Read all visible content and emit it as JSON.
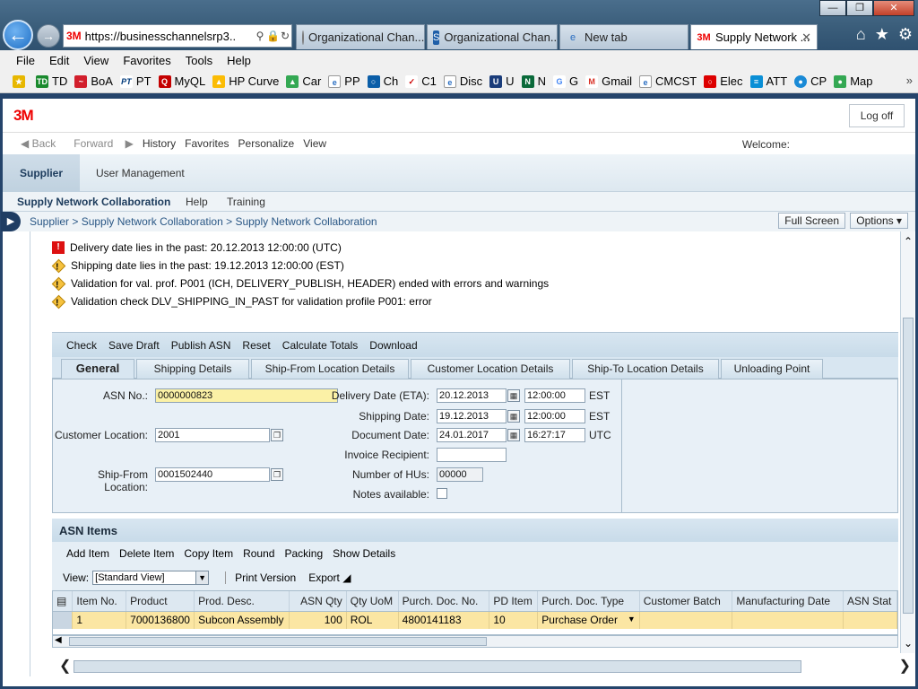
{
  "browser": {
    "address_url": "https://businesschannelsrp3..",
    "tabs": [
      {
        "label": "Organizational Chan..."
      },
      {
        "label": "Organizational Chan..."
      },
      {
        "label": "New tab"
      },
      {
        "label": "Supply Network ..."
      }
    ],
    "menu": [
      "File",
      "Edit",
      "View",
      "Favorites",
      "Tools",
      "Help"
    ],
    "favorites": [
      "TD",
      "BoA",
      "PT",
      "MyQL",
      "HP Curve",
      "Car",
      "PP",
      "Ch",
      "C1",
      "Disc",
      "U",
      "N",
      "G",
      "Gmail",
      "CMCST",
      "Elec",
      "ATT",
      "CP",
      "Map"
    ]
  },
  "portal": {
    "logo": "3M",
    "logoff": "Log off",
    "history": {
      "back": "Back",
      "forward": "Forward",
      "items": [
        "History",
        "Favorites",
        "Personalize",
        "View"
      ]
    },
    "welcome": "Welcome:",
    "level1_tabs": [
      "Supplier",
      "User Management"
    ],
    "level2_tabs": [
      "Supply Network Collaboration",
      "Help",
      "Training"
    ],
    "breadcrumb": "Supplier  >  Supply Network Collaboration  >  Supply Network Collaboration",
    "full_screen": "Full Screen",
    "options": "Options"
  },
  "messages": [
    {
      "type": "error",
      "text": "Delivery date lies in the past: 20.12.2013 12:00:00 (UTC)"
    },
    {
      "type": "warning",
      "text": "Shipping date lies in the past: 19.12.2013 12:00:00 (EST)"
    },
    {
      "type": "warning",
      "text": "Validation for val. prof. P001 (ICH, DELIVERY_PUBLISH, HEADER) ended with errors and warnings"
    },
    {
      "type": "warning",
      "text": "Validation check DLV_SHIPPING_IN_PAST for validation profile P001: error"
    }
  ],
  "actions": [
    "Check",
    "Save Draft",
    "Publish ASN",
    "Reset",
    "Calculate Totals",
    "Download"
  ],
  "detail_tabs": [
    "General",
    "Shipping Details",
    "Ship-From Location Details",
    "Customer Location Details",
    "Ship-To Location Details",
    "Unloading Point"
  ],
  "general": {
    "asn_no_label": "ASN No.:",
    "asn_no": "0000000823",
    "customer_location_label": "Customer Location:",
    "customer_location": "2001",
    "ship_from_label": "Ship-From Location:",
    "ship_from": "0001502440",
    "delivery_date_label": "Delivery Date (ETA):",
    "delivery_date": "20.12.2013",
    "delivery_time": "12:00:00",
    "delivery_tz": "EST",
    "shipping_date_label": "Shipping Date:",
    "shipping_date": "19.12.2013",
    "shipping_time": "12:00:00",
    "shipping_tz": "EST",
    "document_date_label": "Document Date:",
    "document_date": "24.01.2017",
    "document_time": "16:27:17",
    "document_tz": "UTC",
    "invoice_recipient_label": "Invoice Recipient:",
    "invoice_recipient": "",
    "num_hus_label": "Number of HUs:",
    "num_hus": "00000",
    "notes_label": "Notes available:"
  },
  "asn_items": {
    "title": "ASN Items",
    "actions": [
      "Add Item",
      "Delete Item",
      "Copy Item",
      "Round",
      "Packing",
      "Show Details"
    ],
    "view_label": "View:",
    "view_value": "[Standard View]",
    "print_version": "Print Version",
    "export": "Export",
    "columns": [
      "Item No.",
      "Product",
      "Prod. Desc.",
      "ASN Qty",
      "Qty UoM",
      "Purch. Doc. No.",
      "PD Item",
      "Purch. Doc. Type",
      "Customer Batch",
      "Manufacturing Date",
      "ASN Stat"
    ],
    "rows": [
      [
        "1",
        "7000136800",
        "Subcon Assembly",
        "100",
        "ROL",
        "4800141183",
        "10",
        "Purchase Order",
        "",
        "",
        ""
      ]
    ]
  }
}
